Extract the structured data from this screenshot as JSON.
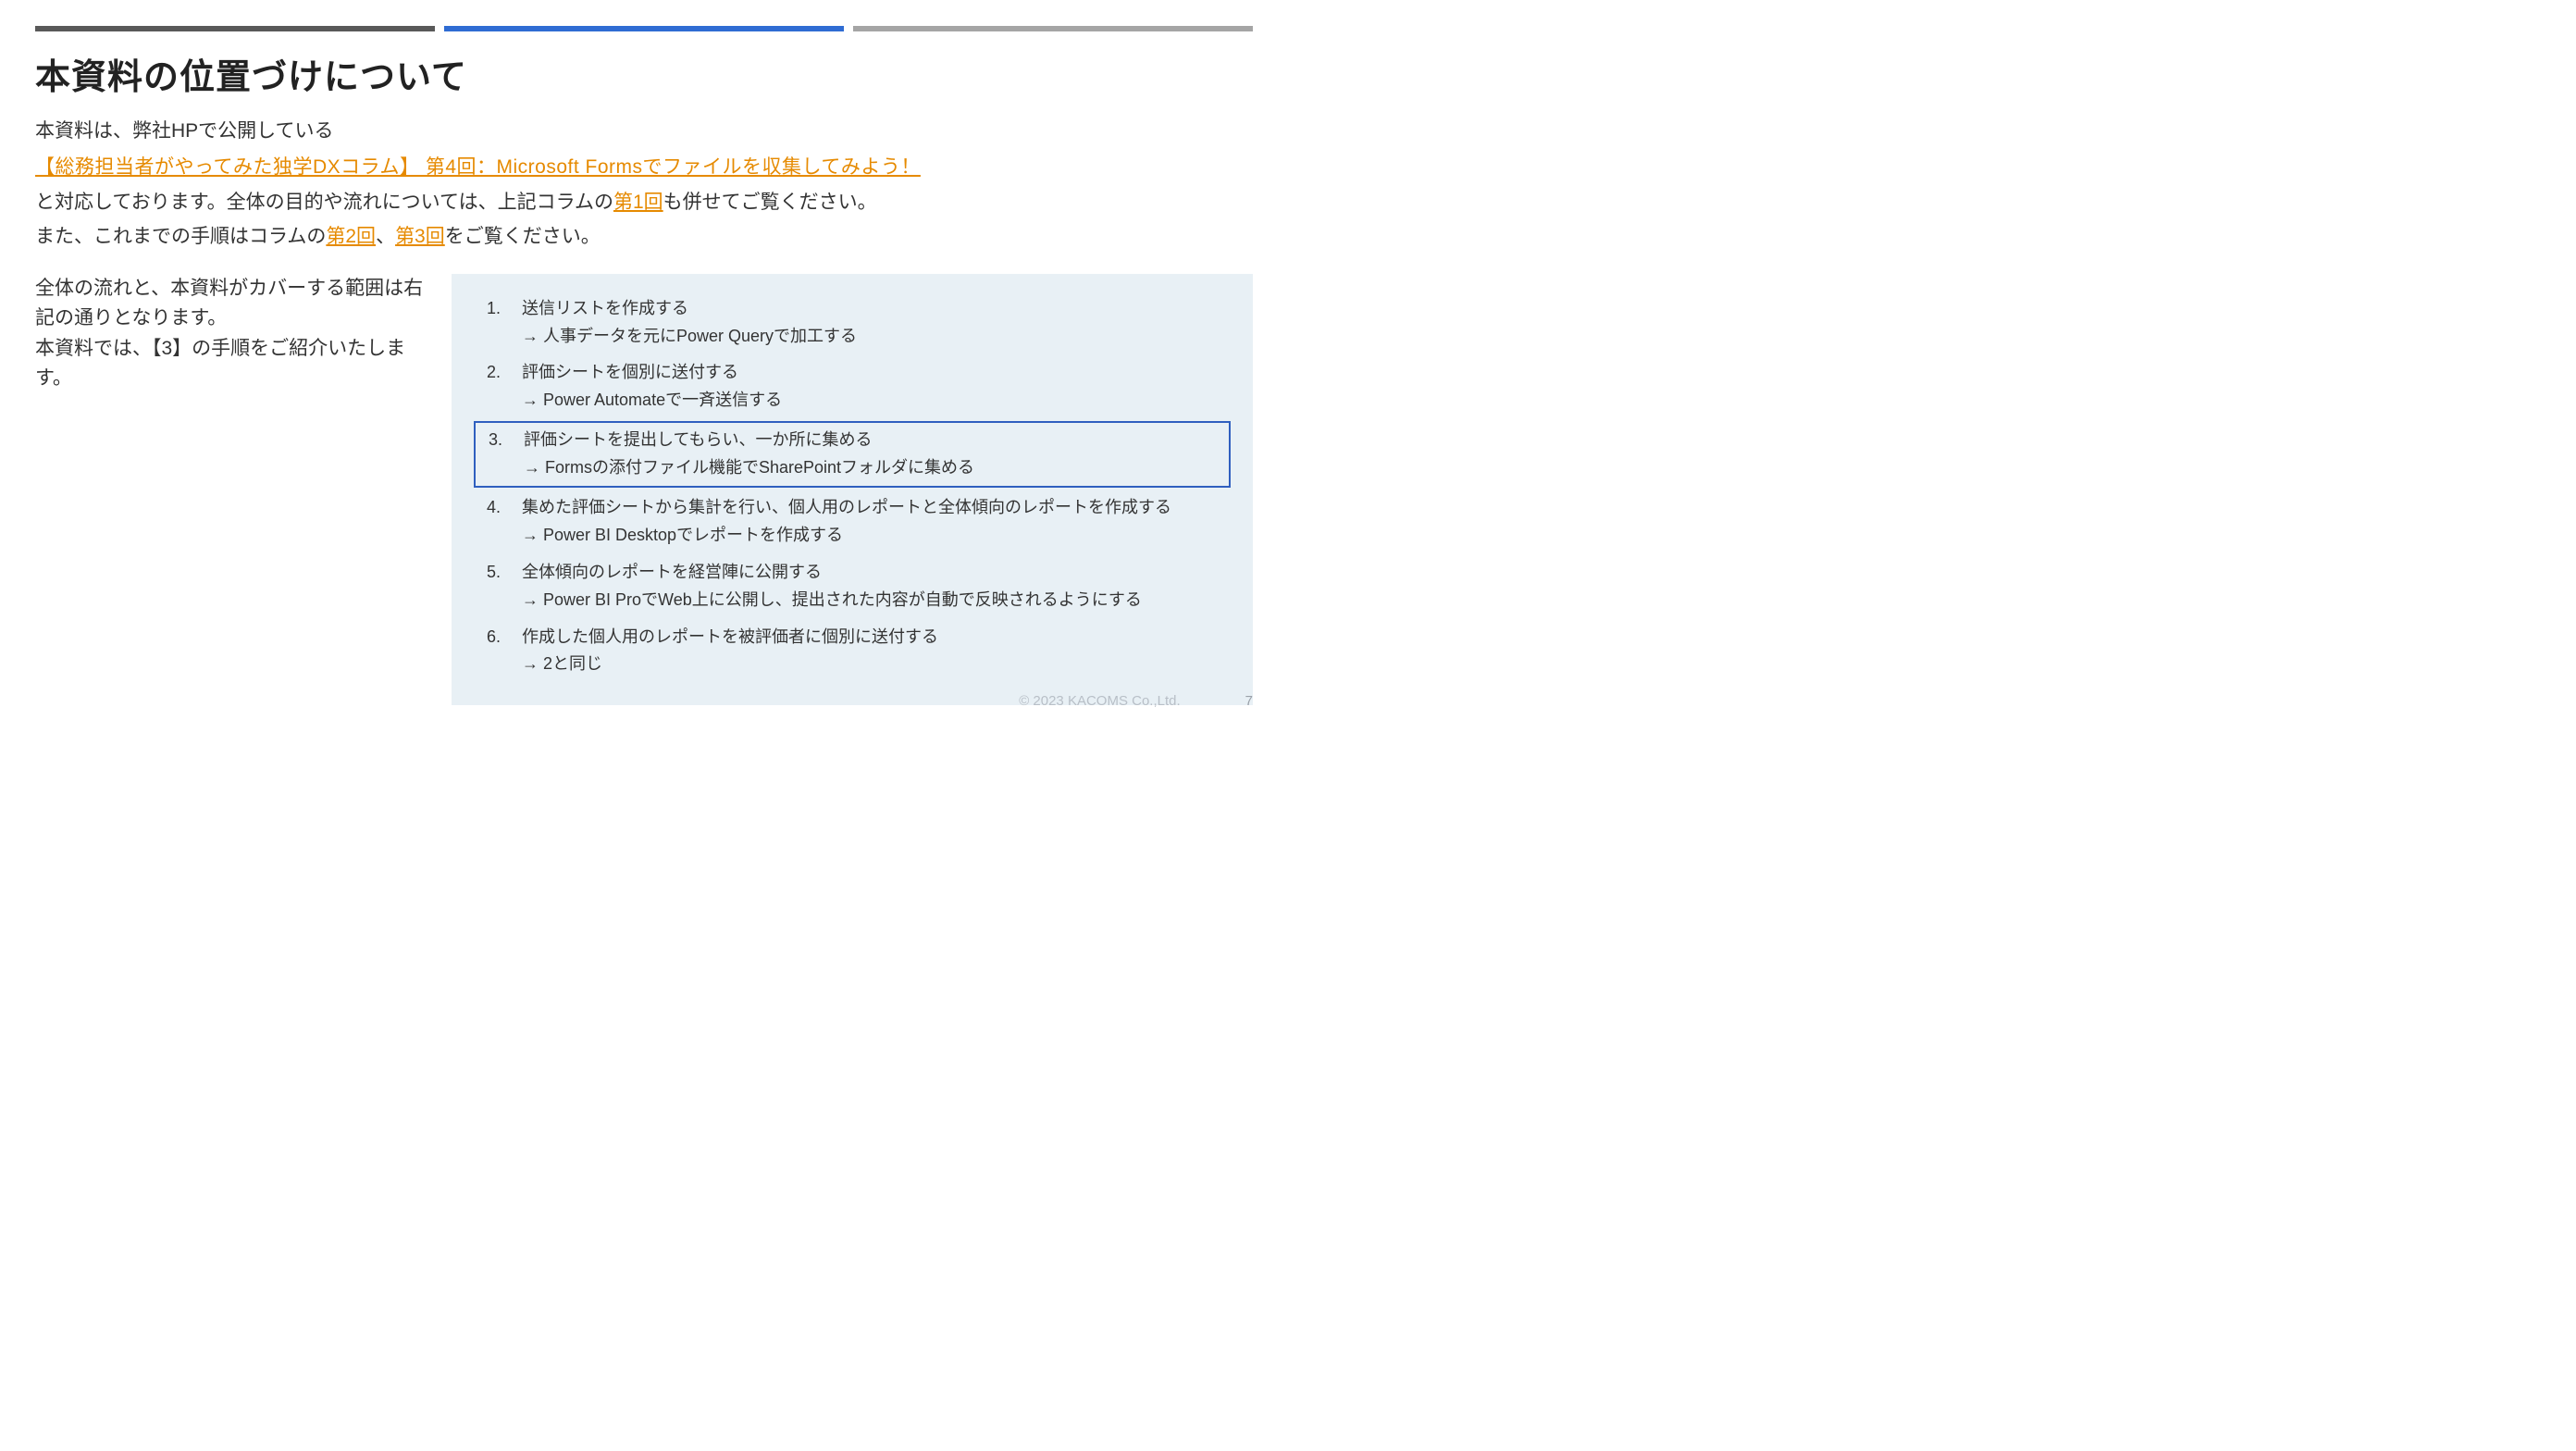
{
  "title": "本資料の位置づけについて",
  "intro": "本資料は、弊社HPで公開している",
  "mainLink": "【総務担当者がやってみた独学DXコラム】 第4回：Microsoft Formsでファイルを収集してみよう！",
  "para1_a": "と対応しております。全体の目的や流れについては、上記コラムの",
  "para1_link": "第1回",
  "para1_b": "も併せてご覧ください。",
  "para2_a": "また、これまでの手順はコラムの",
  "para2_link1": "第2回",
  "para2_mid": "、",
  "para2_link2": "第3回",
  "para2_b": "をご覧ください。",
  "leftText": "全体の流れと、本資料がカバーする範囲は右記の通りとなります。\n本資料では、【3】の手順をご紹介いたします。",
  "highlightedIndex": 2,
  "steps": [
    {
      "title": "送信リストを作成する",
      "sub": "→ 人事データを元にPower Queryで加工する"
    },
    {
      "title": "評価シートを個別に送付する",
      "sub": "→ Power Automateで一斉送信する"
    },
    {
      "title": "評価シートを提出してもらい、一か所に集める",
      "sub": "→ Formsの添付ファイル機能でSharePointフォルダに集める"
    },
    {
      "title": "集めた評価シートから集計を行い、個人用のレポートと全体傾向のレポートを作成する",
      "sub": "→ Power BI Desktopでレポートを作成する"
    },
    {
      "title": "全体傾向のレポートを経営陣に公開する",
      "sub": "→ Power BI ProでWeb上に公開し、提出された内容が自動で反映されるようにする"
    },
    {
      "title": "作成した個人用のレポートを被評価者に個別に送付する",
      "sub": "→ 2と同じ"
    }
  ],
  "copyright": "© 2023 KACOMS Co.,Ltd.",
  "pageNumber": "7"
}
